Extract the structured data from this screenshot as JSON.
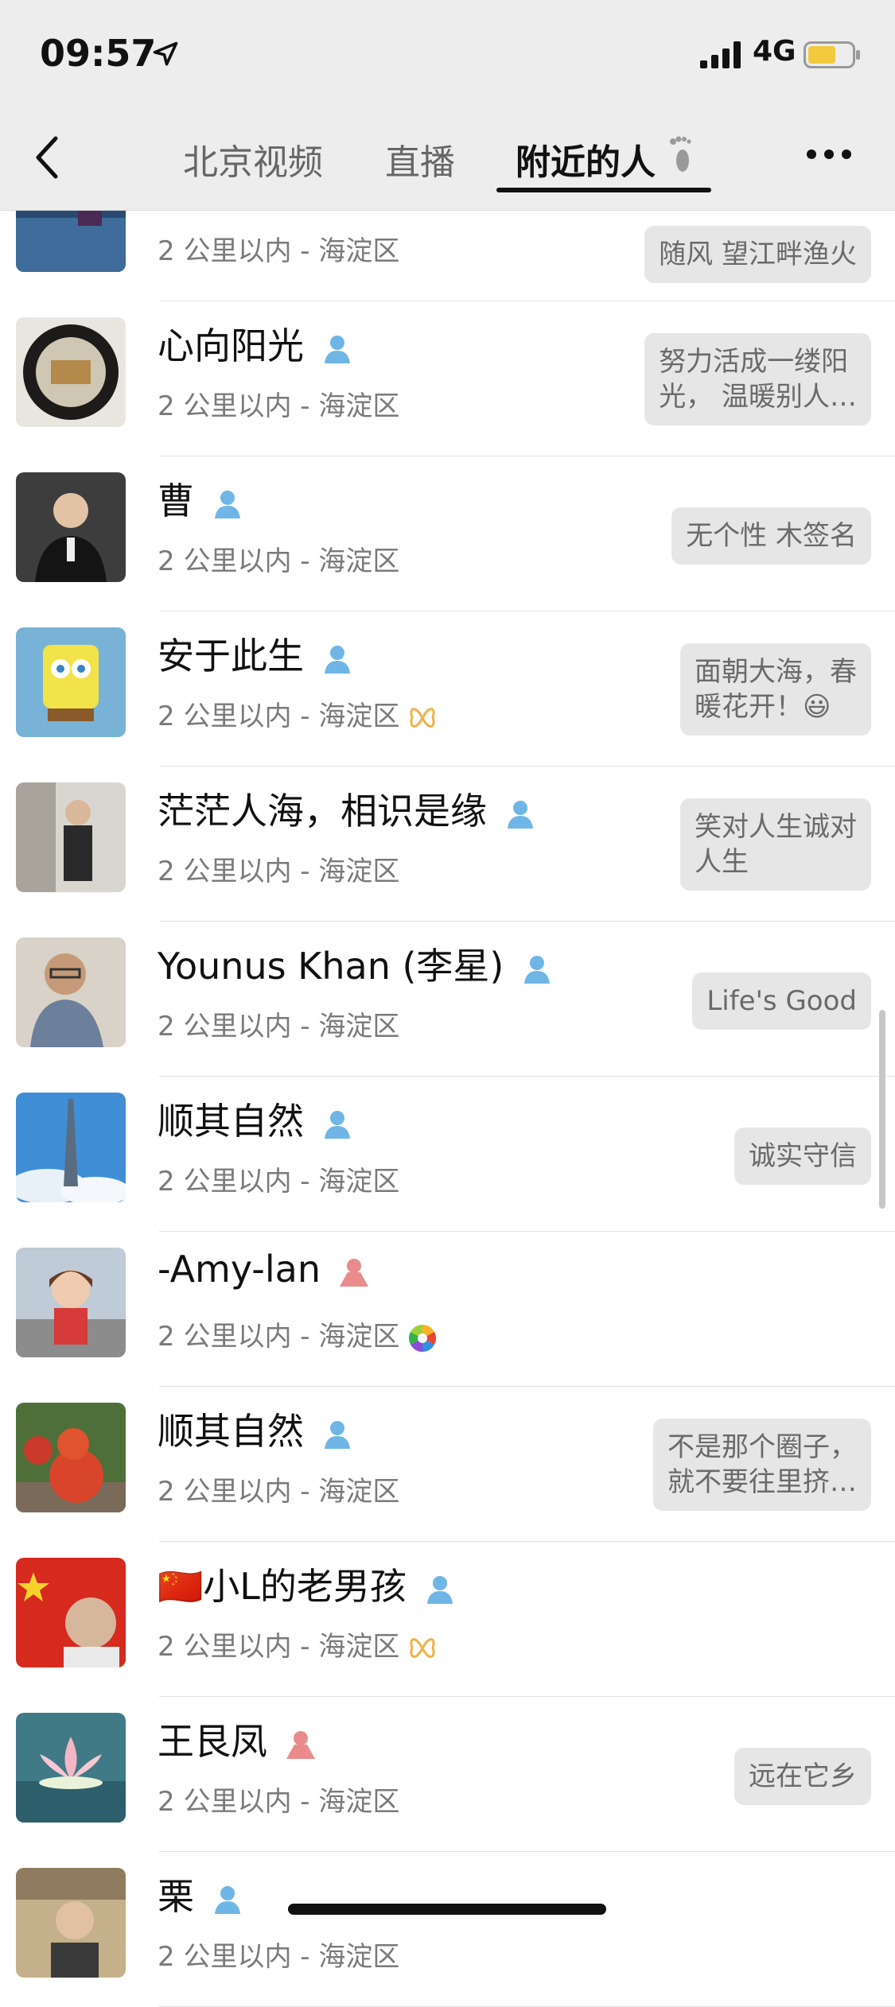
{
  "status": {
    "time": "09:57",
    "network": "4G"
  },
  "nav": {
    "tabs": [
      {
        "label": "北京视频"
      },
      {
        "label": "直播"
      },
      {
        "label": "附近的人"
      }
    ]
  },
  "colors": {
    "male": "#6fb6e6",
    "female": "#e98b8b",
    "accent": "#111111"
  },
  "rows": [
    {
      "name": "",
      "distance": "2 公里以内 - 海淀区",
      "signature": "随风 望江畔渔火",
      "gender": "male",
      "avatar": "avatar-lake"
    },
    {
      "name": "心向阳光",
      "distance": "2 公里以内 - 海淀区",
      "signature": "努力活成一缕阳\n光， 温暖别人…",
      "gender": "male",
      "avatar": "avatar-plate"
    },
    {
      "name": "曹",
      "distance": "2 公里以内 - 海淀区",
      "signature": "无个性   木签名",
      "gender": "male",
      "avatar": "avatar-man-suit"
    },
    {
      "name": "安于此生",
      "distance": "2 公里以内 - 海淀区",
      "signature": "面朝大海，春\n暖花开！😃",
      "gender": "male",
      "avatar": "avatar-sponge",
      "badge": "butterfly-icon"
    },
    {
      "name": "茫茫人海，相识是缘",
      "distance": "2 公里以内 - 海淀区",
      "signature": "笑对人生诚对\n人生",
      "gender": "male",
      "avatar": "avatar-man-office"
    },
    {
      "name": "Younus Khan (李星)",
      "distance": "2 公里以内 - 海淀区",
      "signature": "Life's Good",
      "gender": "male",
      "avatar": "avatar-man-smile"
    },
    {
      "name": "顺其自然",
      "distance": "2 公里以内 - 海淀区",
      "signature": "诚实守信",
      "gender": "male",
      "avatar": "avatar-tower"
    },
    {
      "name": "-Amy-lan",
      "distance": "2 公里以内 - 海淀区",
      "signature": "",
      "gender": "female",
      "avatar": "avatar-girl",
      "badge": "aperture-icon"
    },
    {
      "name": "顺其自然",
      "distance": "2 公里以内 - 海淀区",
      "signature": "不是那个圈子，\n就不要往里挤…",
      "gender": "male",
      "avatar": "avatar-gourd"
    },
    {
      "name": "🇨🇳小L的老男孩",
      "distance": "2 公里以内 - 海淀区",
      "signature": "",
      "gender": "male",
      "avatar": "avatar-flag",
      "badge": "butterfly-icon"
    },
    {
      "name": "王艮凤",
      "distance": "2 公里以内 - 海淀区",
      "signature": "远在它乡",
      "gender": "female",
      "avatar": "avatar-lotus"
    },
    {
      "name": "栗",
      "distance": "2 公里以内 - 海淀区",
      "signature": "",
      "gender": "male",
      "avatar": "avatar-man-room"
    }
  ]
}
